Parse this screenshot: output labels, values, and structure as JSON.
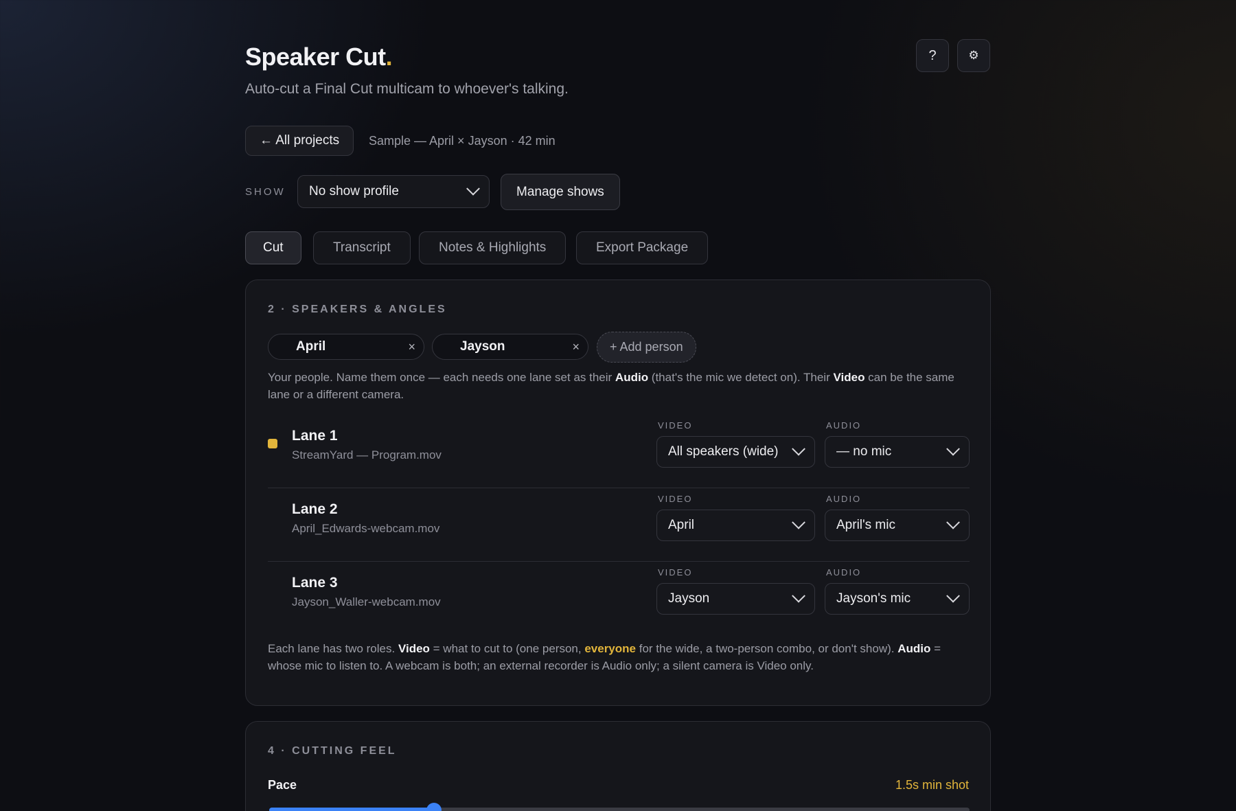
{
  "header": {
    "title": "Speaker Cut",
    "title_dot": ".",
    "subtitle": "Auto-cut a Final Cut multicam to whoever's talking.",
    "help_icon": "?",
    "settings_icon": "⚙"
  },
  "project": {
    "back_label": "← All projects",
    "meta": "Sample — April × Jayson · 42 min"
  },
  "show": {
    "label": "SHOW",
    "selected": "No show profile",
    "manage_label": "Manage shows"
  },
  "tabs": [
    {
      "label": "Cut",
      "active": true
    },
    {
      "label": "Transcript",
      "active": false
    },
    {
      "label": "Notes & Highlights",
      "active": false
    },
    {
      "label": "Export Package",
      "active": false
    }
  ],
  "speakers": {
    "title": "2 · SPEAKERS & ANGLES",
    "people": [
      {
        "name": "April",
        "remove": "×"
      },
      {
        "name": "Jayson",
        "remove": "×"
      }
    ],
    "add_label": "+ Add person",
    "intro": {
      "t1": "Your people. Name them once — each needs one lane set as their ",
      "b1": "Audio",
      "t2": " (that's the mic we detect on). Their ",
      "b2": "Video",
      "t3": " can be the same lane or a different camera."
    },
    "video_label": "VIDEO",
    "audio_label": "AUDIO",
    "lanes": [
      {
        "name": "Lane 1",
        "file": "StreamYard — Program.mov",
        "video": "All speakers (wide)",
        "audio": "— no mic",
        "marker_color": "#e2b53b"
      },
      {
        "name": "Lane 2",
        "file": "April_Edwards-webcam.mov",
        "video": "April",
        "audio": "April's mic"
      },
      {
        "name": "Lane 3",
        "file": "Jayson_Waller-webcam.mov",
        "video": "Jayson",
        "audio": "Jayson's mic"
      }
    ],
    "footer": {
      "t1": "Each lane has two roles. ",
      "b1": "Video",
      "t2": " = what to cut to (one person, ",
      "accent": "everyone",
      "t3": " for the wide, a two-person combo, or don't show). ",
      "b2": "Audio",
      "t4": " = whose mic to listen to. A webcam is both; an external recorder is Audio only; a silent camera is Video only."
    }
  },
  "cutting": {
    "title": "4 · CUTTING FEEL",
    "pace_label": "Pace",
    "pace_value": "1.5s min shot",
    "pace_fraction": 0.235
  },
  "colors": {
    "accent": "#e2b53b",
    "slider": "#3b82f6"
  }
}
